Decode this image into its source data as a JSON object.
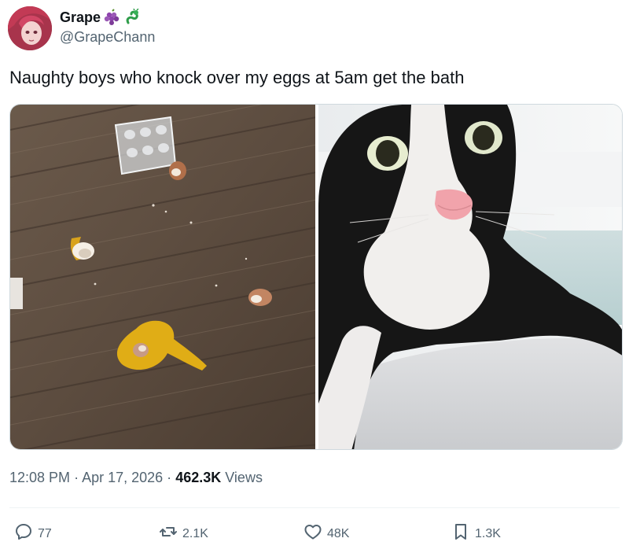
{
  "author": {
    "display_name": "Grape",
    "handle": "@GrapeChann",
    "badges": [
      "grapes-emoji",
      "dragon-emoji"
    ]
  },
  "tweet": {
    "text": "Naughty boys who knock over my eggs at 5am get the bath",
    "media": [
      {
        "name": "broken-eggs-on-floor-photo"
      },
      {
        "name": "wet-black-white-cat-photo"
      }
    ]
  },
  "meta": {
    "time": "12:08 PM",
    "separator": "·",
    "date": "Apr 17, 2026",
    "views_count": "462.3K",
    "views_label": "Views"
  },
  "actions": {
    "replies": "77",
    "reposts": "2.1K",
    "likes": "48K",
    "bookmarks": "1.3K"
  },
  "colors": {
    "text_primary": "#0f1419",
    "text_secondary": "#536471",
    "border": "#cfd9de"
  }
}
